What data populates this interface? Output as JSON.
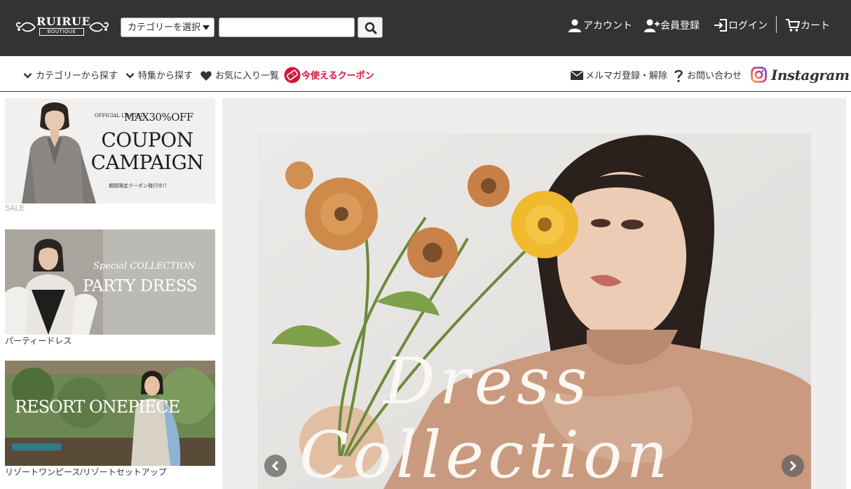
{
  "header": {
    "logo_text": "RUIRUE",
    "logo_sub": "BOUTIQUE",
    "category_select": "カテゴリーを選択",
    "search_placeholder": "",
    "links": {
      "account": "アカウント",
      "register": "会員登録",
      "login": "ログイン",
      "cart": "カート"
    }
  },
  "nav": {
    "category": "カテゴリーから探す",
    "feature": "特集から探す",
    "favorites": "お気に入り一覧",
    "coupon": "今使えるクーポン",
    "newsletter": "メルマガ登録・解除",
    "contact": "お問い合わせ",
    "instagram": "Instagram"
  },
  "sidebar": {
    "banners": [
      {
        "line1": "OFFICIAL LIMITED",
        "line2": "MAX30%OFF",
        "line3": "COUPON CAMPAIGN",
        "line4": "期間限定クーポン発行中!!",
        "caption": "SALE"
      },
      {
        "line1": "Special COLLECTION",
        "line2": "PARTY DRESS",
        "caption": "パーティードレス"
      },
      {
        "line1": "RESORT ONEPIECE",
        "caption": "リゾートワンピース/リゾートセットアップ"
      }
    ]
  },
  "hero": {
    "script_line1": "Dress",
    "script_line2": "Collection"
  },
  "colors": {
    "header_bg": "#333333",
    "coupon_red": "#d6143b"
  }
}
